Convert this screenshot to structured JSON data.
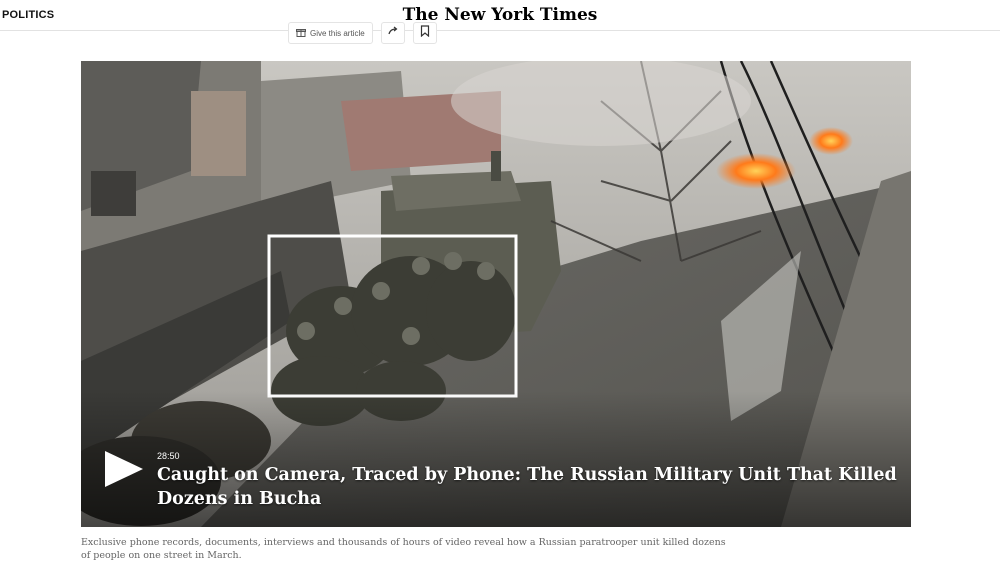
{
  "header": {
    "section": "POLITICS",
    "logo": "The New York Times"
  },
  "toolbar": {
    "gift_label": "Give this article",
    "share_icon": "share-icon",
    "bookmark_icon": "bookmark-icon"
  },
  "video": {
    "duration": "28:50",
    "headline": "Caught on Camera, Traced by Phone: The Russian Military Unit That Killed Dozens in Bucha",
    "play_icon": "play-icon"
  },
  "caption": "Exclusive phone records, documents, interviews and thousands of hours of video reveal how a Russian paratrooper unit killed dozens of people on one street in March.",
  "colors": {
    "text": "#121212",
    "caption": "#666666",
    "overlay_text": "#ffffff",
    "fire": "#ff7a1a"
  }
}
